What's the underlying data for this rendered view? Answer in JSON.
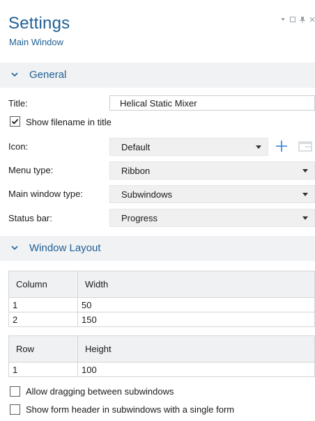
{
  "header": {
    "title": "Settings",
    "subtitle": "Main Window"
  },
  "window_controls": [
    "dropdown-icon",
    "maximize-icon",
    "pin-icon",
    "close-icon"
  ],
  "sections": {
    "general": {
      "label": "General"
    },
    "layout": {
      "label": "Window Layout"
    }
  },
  "general": {
    "title_label": "Title:",
    "title_value": "Helical Static Mixer",
    "show_filename_label": "Show filename in title",
    "show_filename_checked": true,
    "icon_label": "Icon:",
    "icon_value": "Default",
    "menu_type_label": "Menu type:",
    "menu_type_value": "Ribbon",
    "main_window_type_label": "Main window type:",
    "main_window_type_value": "Subwindows",
    "status_bar_label": "Status bar:",
    "status_bar_value": "Progress"
  },
  "columns_table": {
    "headers": [
      "Column",
      "Width"
    ],
    "rows": [
      [
        "1",
        "50"
      ],
      [
        "2",
        "150"
      ]
    ]
  },
  "rows_table": {
    "headers": [
      "Row",
      "Height"
    ],
    "rows": [
      [
        "1",
        "100"
      ]
    ]
  },
  "options": {
    "allow_dragging_label": "Allow dragging between subwindows",
    "allow_dragging_checked": false,
    "show_form_header_label": "Show form header in subwindows with a single form",
    "show_form_header_checked": false
  },
  "colors": {
    "accent": "#1f5f95",
    "section_bg": "#f1f2f4",
    "add_icon": "#2f7ed8"
  }
}
